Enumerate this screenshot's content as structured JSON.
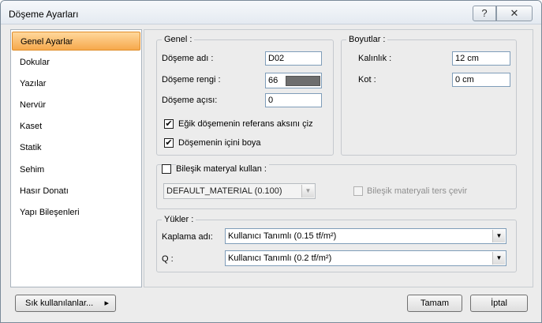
{
  "window": {
    "title": "Döşeme Ayarları",
    "help_icon": "?",
    "close_icon": "✕"
  },
  "sidebar": {
    "items": [
      {
        "label": "Genel Ayarlar",
        "active": true
      },
      {
        "label": "Dokular"
      },
      {
        "label": "Yazılar"
      },
      {
        "label": "Nervür"
      },
      {
        "label": "Kaset"
      },
      {
        "label": "Statik"
      },
      {
        "label": "Sehim"
      },
      {
        "label": "Hasır Donatı"
      },
      {
        "label": "Yapı Bileşenleri"
      }
    ]
  },
  "genel": {
    "legend": "Genel :",
    "name_label": "Döşeme adı  :",
    "name_value": "D02",
    "color_label": "Döşeme rengi :",
    "color_value": "66",
    "color_swatch": "#6e6e6e",
    "angle_label": "Döşeme açısı:",
    "angle_value": "0",
    "check_ref_label": "Eğik döşemenin referans aksını çiz",
    "check_ref_checked": "✔",
    "check_paint_label": "Döşemenin içini boya",
    "check_paint_checked": "✔"
  },
  "boyutlar": {
    "legend": "Boyutlar :",
    "thickness_label": "Kalınlık  :",
    "thickness_value": "12 cm",
    "kot_label": "Kot  :",
    "kot_value": "0 cm"
  },
  "composite": {
    "check_label": "Bileşik materyal kullan :",
    "material_value": "DEFAULT_MATERIAL (0.100)",
    "reverse_label": "Bileşik materyali ters çevir"
  },
  "yukler": {
    "legend": "Yükler :",
    "cover_label": "Kaplama adı:",
    "cover_value": "Kullanıcı Tanımlı (0.15 tf/m²)",
    "q_label": "Q :",
    "q_value": "Kullanıcı Tanımlı (0.2 tf/m²)"
  },
  "footer": {
    "favorites_label": "Sık kullanılanlar...",
    "favorites_arrow": "▸",
    "ok_label": "Tamam",
    "cancel_label": "İptal"
  },
  "icons": {
    "dropdown_arrow": "▼"
  }
}
